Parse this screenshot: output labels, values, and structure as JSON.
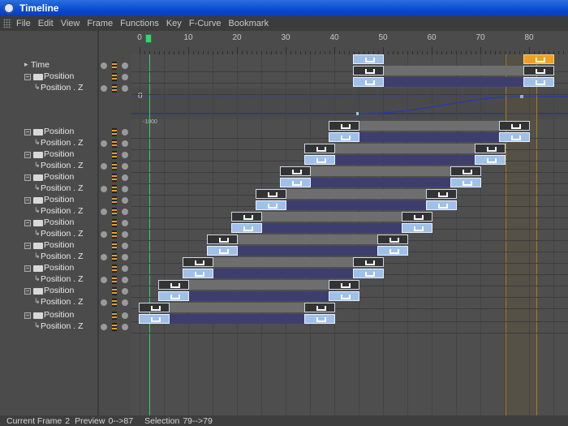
{
  "window": {
    "title": "Timeline"
  },
  "menu": [
    "File",
    "Edit",
    "View",
    "Frame",
    "Functions",
    "Key",
    "F-Curve",
    "Bookmark"
  ],
  "ruler": {
    "labels": [
      "0",
      "2",
      "10",
      "20",
      "30",
      "40",
      "50",
      "60",
      "70",
      "80"
    ]
  },
  "tree": [
    {
      "label": "Time",
      "kind": "time"
    },
    {
      "label": "Position",
      "kind": "group"
    },
    {
      "label": "Position . Z",
      "kind": "track"
    },
    {
      "label": "Position",
      "kind": "group"
    },
    {
      "label": "Position . Z",
      "kind": "track"
    },
    {
      "label": "Position",
      "kind": "group"
    },
    {
      "label": "Position . Z",
      "kind": "track"
    },
    {
      "label": "Position",
      "kind": "group"
    },
    {
      "label": "Position . Z",
      "kind": "track"
    },
    {
      "label": "Position",
      "kind": "group"
    },
    {
      "label": "Position . Z",
      "kind": "track"
    },
    {
      "label": "Position",
      "kind": "group"
    },
    {
      "label": "Position . Z",
      "kind": "track"
    },
    {
      "label": "Position",
      "kind": "group"
    },
    {
      "label": "Position . Z",
      "kind": "track"
    },
    {
      "label": "Position",
      "kind": "group"
    },
    {
      "label": "Position . Z",
      "kind": "track"
    },
    {
      "label": "Position",
      "kind": "group"
    },
    {
      "label": "Position . Z",
      "kind": "track"
    },
    {
      "label": "Position",
      "kind": "group"
    },
    {
      "label": "Position . Z",
      "kind": "track"
    }
  ],
  "curve": {
    "value_label": "0",
    "sub_label": "-1000"
  },
  "colors": {
    "key_fill": "#9fc0e8",
    "selected_key": "#f0a020",
    "playhead": "#30d070",
    "bar_blue": "#3e3e6e",
    "bar_gray": "#6e6e6e"
  },
  "status": {
    "current_frame_label": "Current Frame",
    "current_frame": "2",
    "preview_label": "Preview",
    "preview_range": "0-->87",
    "selection_label": "Selection",
    "selection_range": "79-->79"
  }
}
